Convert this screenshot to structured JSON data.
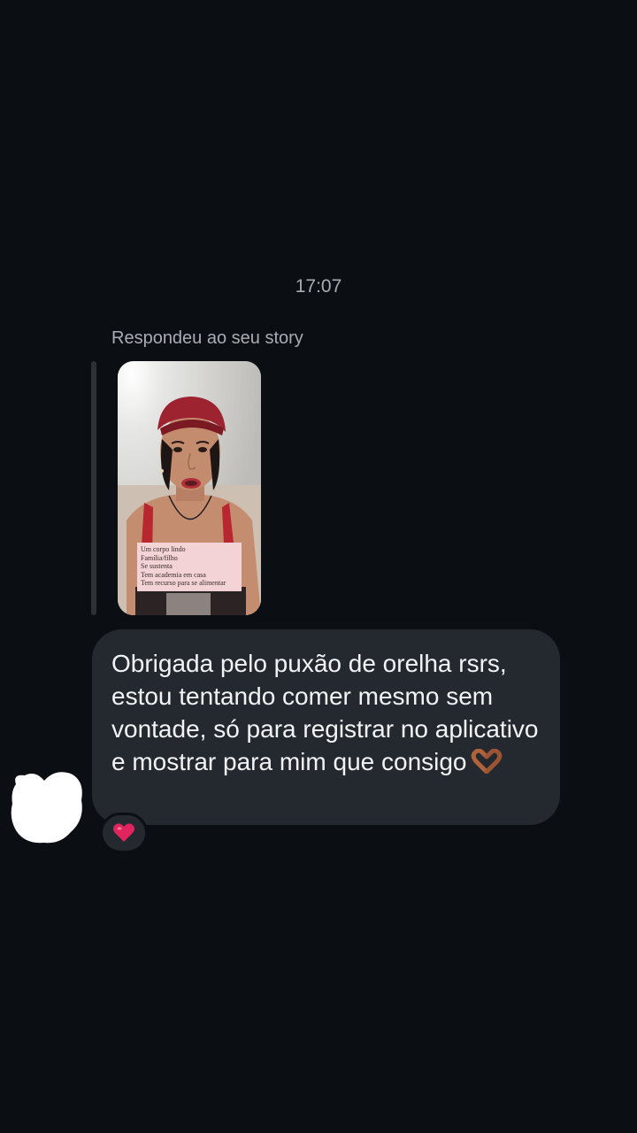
{
  "conversation": {
    "timestamp": "17:07",
    "reply_caption": "Respondeu ao seu story",
    "story": {
      "overlay_lines": [
        "Um corpo lindo",
        "Família/filho",
        "Se sustenta",
        "Tem academia em casa",
        "Tem recurso para se alimentar"
      ]
    },
    "message": {
      "text": "Obrigada pelo puxão de orelha rsrs, estou tentando comer mesmo sem vontade, só para registrar no aplicativo e mostrar para mim que consigo",
      "emoji_icon": "heart-hands-icon"
    },
    "reaction": {
      "icon": "red-heart-icon",
      "color": "#e0245e"
    }
  },
  "colors": {
    "background": "#0b0f14",
    "bubble": "#24292f",
    "secondary_text": "#a8adb5"
  }
}
